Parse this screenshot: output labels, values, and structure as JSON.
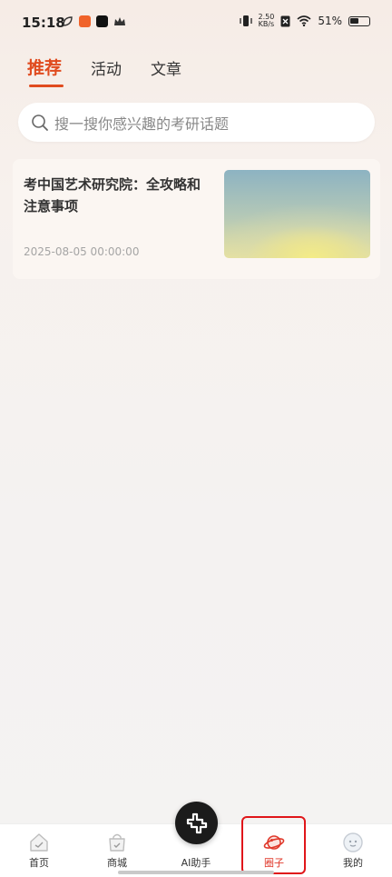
{
  "status_bar": {
    "time": "15:18",
    "net_speed_value": "2.50",
    "net_speed_unit": "KB/s",
    "battery_percent": "51%"
  },
  "tabs": [
    {
      "label": "推荐",
      "active": true
    },
    {
      "label": "活动",
      "active": false
    },
    {
      "label": "文章",
      "active": false
    }
  ],
  "search": {
    "placeholder": "搜一搜你感兴趣的考研话题"
  },
  "articles": [
    {
      "title": "考中国艺术研究院：全攻略和注意事项",
      "date": "2025-08-05 00:00:00"
    }
  ],
  "bottom_nav": {
    "home": "首页",
    "mall": "商城",
    "ai": "AI助手",
    "circle": "圈子",
    "mine": "我的",
    "active": "圈子"
  },
  "colors": {
    "accent": "#e04b1f",
    "highlight": "#e0161a"
  }
}
